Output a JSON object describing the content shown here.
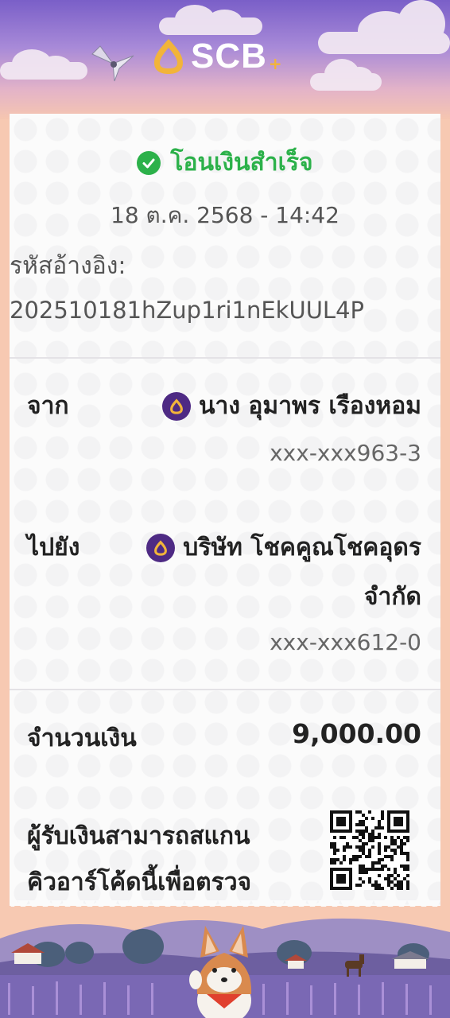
{
  "header": {
    "brand": "SCB",
    "brand_plus": "+"
  },
  "slip": {
    "status": "โอนเงินสำเร็จ",
    "datetime": "18 ต.ค. 2568 - 14:42",
    "reference_label": "รหัสอ้างอิง:",
    "reference_value": "202510181hZup1ri1nEkUUL4P",
    "from": {
      "label": "จาก",
      "name": "นาง อุมาพร เรืองหอม",
      "account": "xxx-xxx963-3"
    },
    "to": {
      "label": "ไปยัง",
      "name_line1": "บริษัท โชคคูณโชคอุดร",
      "name_line2": "จำกัด",
      "account": "xxx-xxx612-0"
    },
    "amount": {
      "label": "จำนวนเงิน",
      "value": "9,000.00"
    },
    "qr_note": {
      "line1": "ผู้รับเงินสามารถสแกน",
      "line2": "คิวอาร์โค้ดนี้เพื่อตรวจ"
    }
  },
  "colors": {
    "success": "#2cb14a",
    "scb_purple": "#4e2a84",
    "scb_gold": "#f2b43a"
  },
  "icons": {
    "status": "check-circle-icon",
    "bank": "scb-bank-icon",
    "verify": "qr-code"
  }
}
